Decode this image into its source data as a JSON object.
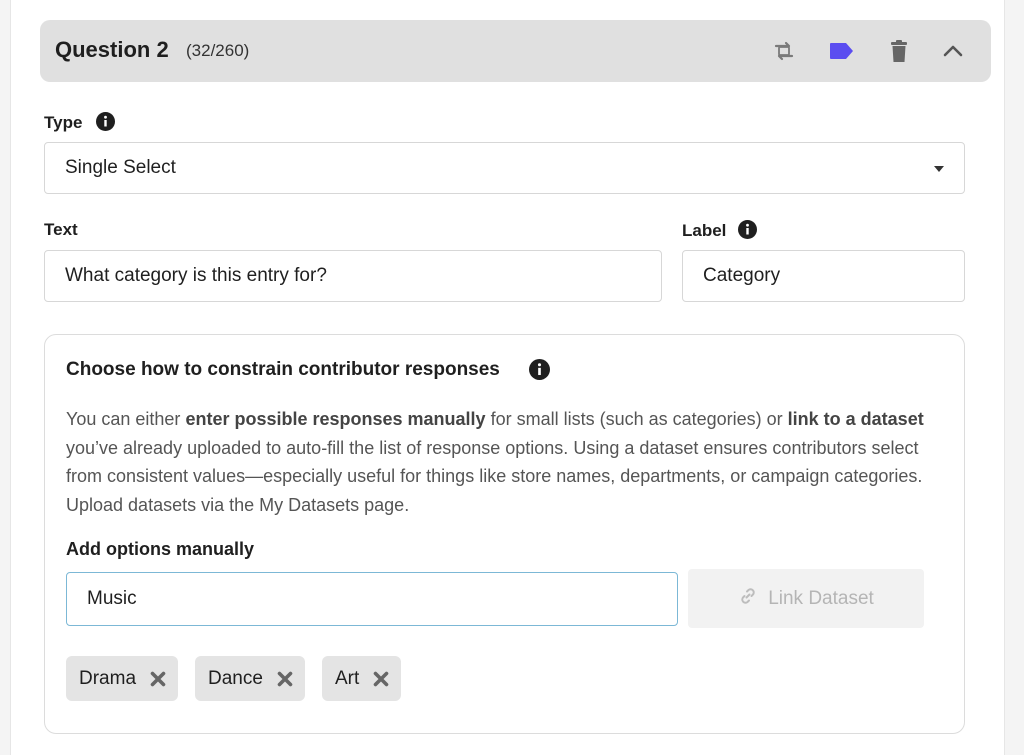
{
  "question": {
    "title": "Question 2",
    "count": "(32/260)",
    "icons": [
      "swap-icon",
      "tag-icon",
      "trash-icon",
      "chevron-up-icon"
    ],
    "tag_color": "#5b4df0"
  },
  "type_field": {
    "label": "Type",
    "value": "Single Select"
  },
  "text_field": {
    "label": "Text",
    "value": "What category is this entry for?"
  },
  "label_field": {
    "label": "Label",
    "value": "Category"
  },
  "constrain": {
    "title": "Choose how to constrain contributor responses",
    "desc_part1": "You can either ",
    "desc_bold1": "enter possible responses manually",
    "desc_part2": " for small lists (such as categories) or ",
    "desc_bold2": "link to a dataset",
    "desc_part3": " you’ve already uploaded to auto-fill the list of response options. Using a dataset ensures contributors select from consistent values—especially useful for things like store names, departments, or campaign categories. Upload datasets via the My Datasets page.",
    "manual_label": "Add options manually",
    "option_input_value": "Music",
    "link_button": "Link Dataset",
    "chips": [
      "Drama",
      "Dance",
      "Art"
    ]
  }
}
